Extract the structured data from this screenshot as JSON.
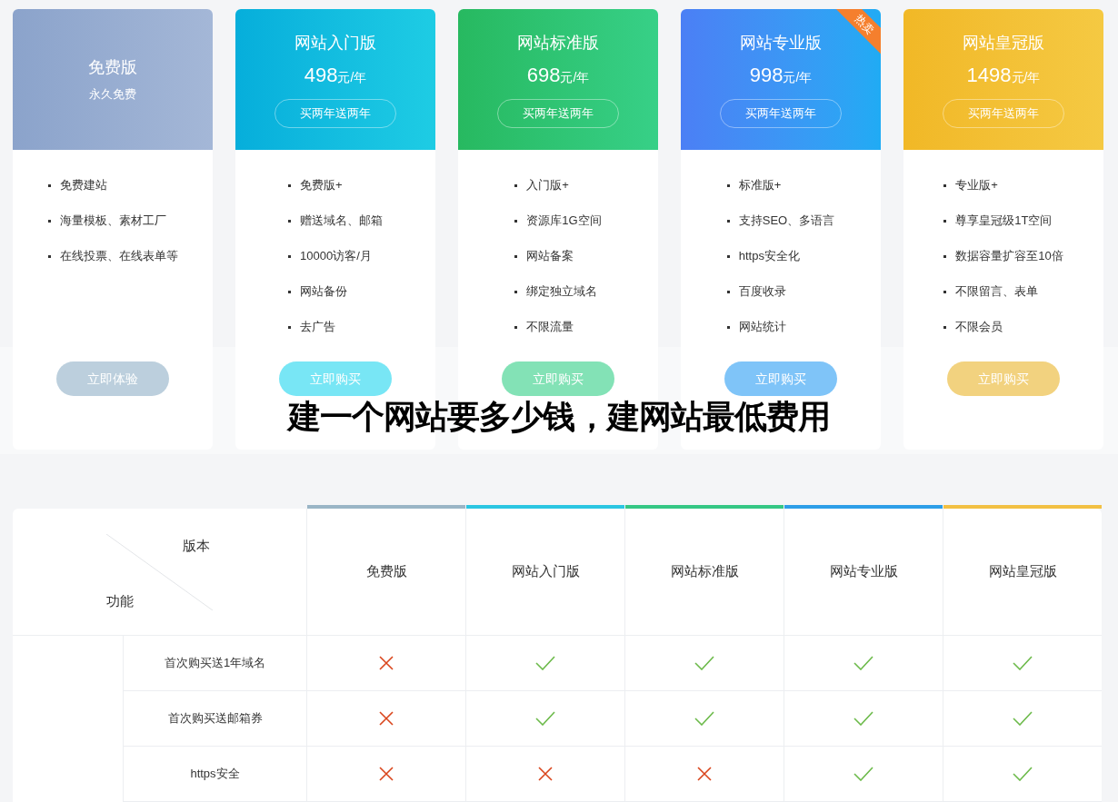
{
  "plans": [
    {
      "kind": "free",
      "name": "免费版",
      "subtitle": "永久免费",
      "hot": false,
      "features": [
        "免费建站",
        "海量模板、素材工厂",
        "在线投票、在线表单等"
      ],
      "button": "立即体验"
    },
    {
      "kind": "paid",
      "name": "网站入门版",
      "price": "498",
      "unit": "元/年",
      "promo": "买两年送两年",
      "hot": false,
      "features": [
        "免费版+",
        "赠送域名、邮箱",
        "10000访客/月",
        "网站备份",
        "去广告"
      ],
      "button": "立即购买"
    },
    {
      "kind": "paid",
      "name": "网站标准版",
      "price": "698",
      "unit": "元/年",
      "promo": "买两年送两年",
      "hot": false,
      "features": [
        "入门版+",
        "资源库1G空间",
        "网站备案",
        "绑定独立域名",
        "不限流量"
      ],
      "button": "立即购买"
    },
    {
      "kind": "paid",
      "name": "网站专业版",
      "price": "998",
      "unit": "元/年",
      "promo": "买两年送两年",
      "hot": true,
      "badge": "热卖",
      "features": [
        "标准版+",
        "支持SEO、多语言",
        "https安全化",
        "百度收录",
        "网站统计"
      ],
      "button": "立即购买"
    },
    {
      "kind": "paid",
      "name": "网站皇冠版",
      "price": "1498",
      "unit": "元/年",
      "promo": "买两年送两年",
      "hot": false,
      "features": [
        "专业版+",
        "尊享皇冠级1T空间",
        "数据容量扩容至10倍",
        "不限留言、表单",
        "不限会员"
      ],
      "button": "立即购买"
    }
  ],
  "overlay_title": "建一个网站要多少钱，建网站最低费用",
  "comparison": {
    "version_label": "版本",
    "feature_label": "功能",
    "columns": [
      "免费版",
      "网站入门版",
      "网站标准版",
      "网站专业版",
      "网站皇冠版"
    ],
    "rows": [
      {
        "feature": "首次购买送1年域名",
        "included": [
          false,
          true,
          true,
          true,
          true
        ]
      },
      {
        "feature": "首次购买送邮箱券",
        "included": [
          false,
          true,
          true,
          true,
          true
        ]
      },
      {
        "feature": "https安全",
        "included": [
          false,
          false,
          false,
          true,
          true
        ]
      }
    ]
  }
}
